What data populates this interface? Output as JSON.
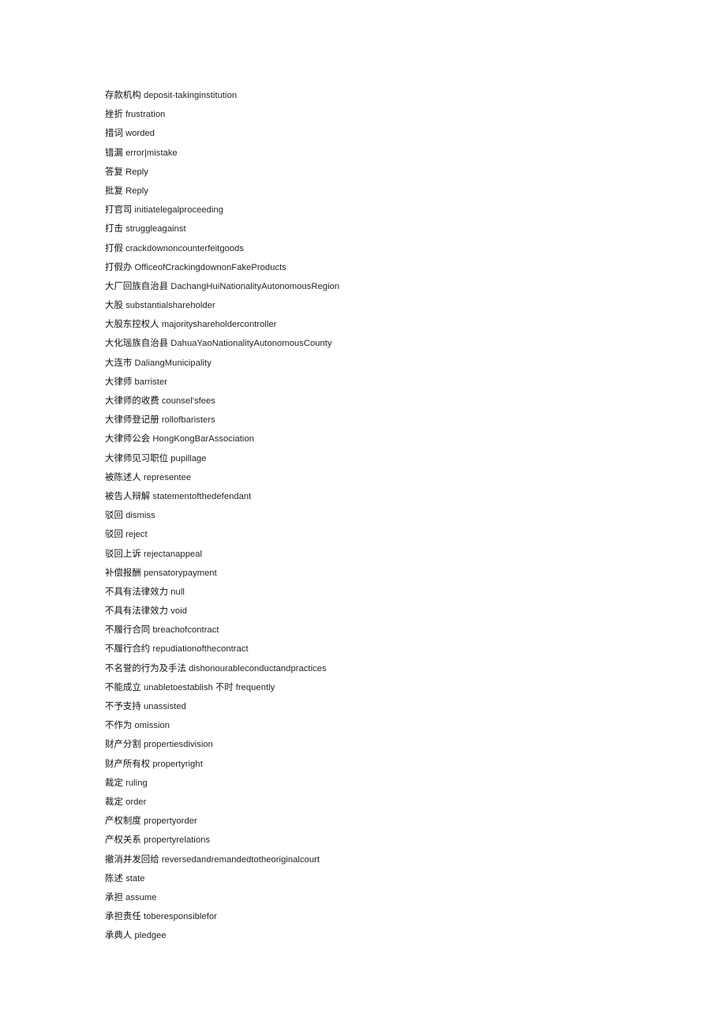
{
  "document": {
    "type": "glossary-page",
    "language_pair": "Chinese-English",
    "background_color": "#ffffff",
    "text_color": "#1a1a1a",
    "entry_count": 45
  },
  "entries": [
    {
      "term": "存款机构",
      "gloss": "deposit-takinginstitution"
    },
    {
      "term": "挫折",
      "gloss": "frustration"
    },
    {
      "term": "措词",
      "gloss": "worded"
    },
    {
      "term": "错漏",
      "gloss": "error|mistake"
    },
    {
      "term": "答复",
      "gloss": "Reply"
    },
    {
      "term": "批复",
      "gloss": "Reply"
    },
    {
      "term": "打官司",
      "gloss": "initiatelegalproceeding"
    },
    {
      "term": "打击",
      "gloss": "struggleagainst"
    },
    {
      "term": "打假",
      "gloss": "crackdownoncounterfeitgoods"
    },
    {
      "term": "打假办",
      "gloss": "OfficeofCrackingdownonFakeProducts"
    },
    {
      "term": "大厂回族自治县",
      "gloss": "DachangHuiNationalityAutonomousRegion"
    },
    {
      "term": "大股",
      "gloss": "substantialshareholder"
    },
    {
      "term": "大股东控权人",
      "gloss": "majorityshareholdercontroller"
    },
    {
      "term": "大化瑶族自治县",
      "gloss": "DahuaYaoNationalityAutonomousCounty"
    },
    {
      "term": "大连市",
      "gloss": "DaliangMunicipality"
    },
    {
      "term": "大律师",
      "gloss": "barrister"
    },
    {
      "term": "大律师的收费",
      "gloss": "counsel'sfees"
    },
    {
      "term": "大律师登记册",
      "gloss": "rollofbaristers"
    },
    {
      "term": "大律师公会",
      "gloss": "HongKongBarAssociation"
    },
    {
      "term": "大律师见习职位",
      "gloss": "pupillage"
    },
    {
      "term": "被陈述人",
      "gloss": "representee"
    },
    {
      "term": "被告人辩解",
      "gloss": "statementofthedefendant"
    },
    {
      "term": "驳回",
      "gloss": "dismiss"
    },
    {
      "term": "驳回",
      "gloss": "reject"
    },
    {
      "term": "驳回上诉",
      "gloss": "rejectanappeal"
    },
    {
      "term": "补偿报酬",
      "gloss": "pensatorypayment"
    },
    {
      "term": "不具有法律效力",
      "gloss": "null"
    },
    {
      "term": "不具有法律效力",
      "gloss": "void"
    },
    {
      "term": "不履行合同",
      "gloss": "breachofcontract"
    },
    {
      "term": "不履行合约",
      "gloss": "repudiationofthecontract"
    },
    {
      "term": "不名誉的行为及手法",
      "gloss": "dishonourableconductandpractices"
    },
    {
      "term": "不能成立",
      "gloss": "unabletoestablish 不时 frequently"
    },
    {
      "term": "不予支持",
      "gloss": "unassisted"
    },
    {
      "term": "不作为",
      "gloss": "omission"
    },
    {
      "term": "财产分割",
      "gloss": "propertiesdivision"
    },
    {
      "term": "财产所有权",
      "gloss": "propertyright"
    },
    {
      "term": "裁定",
      "gloss": "ruling"
    },
    {
      "term": "裁定",
      "gloss": "order"
    },
    {
      "term": "产权制度",
      "gloss": "propertyorder"
    },
    {
      "term": "产权关系",
      "gloss": "propertyrelations"
    },
    {
      "term": "撤消并发回给",
      "gloss": "reversedandremandedtotheoriginalcourt"
    },
    {
      "term": "陈述",
      "gloss": "state"
    },
    {
      "term": "承担",
      "gloss": "assume"
    },
    {
      "term": "承担责任",
      "gloss": "toberesponsiblefor"
    },
    {
      "term": "承典人",
      "gloss": "pledgee"
    }
  ]
}
